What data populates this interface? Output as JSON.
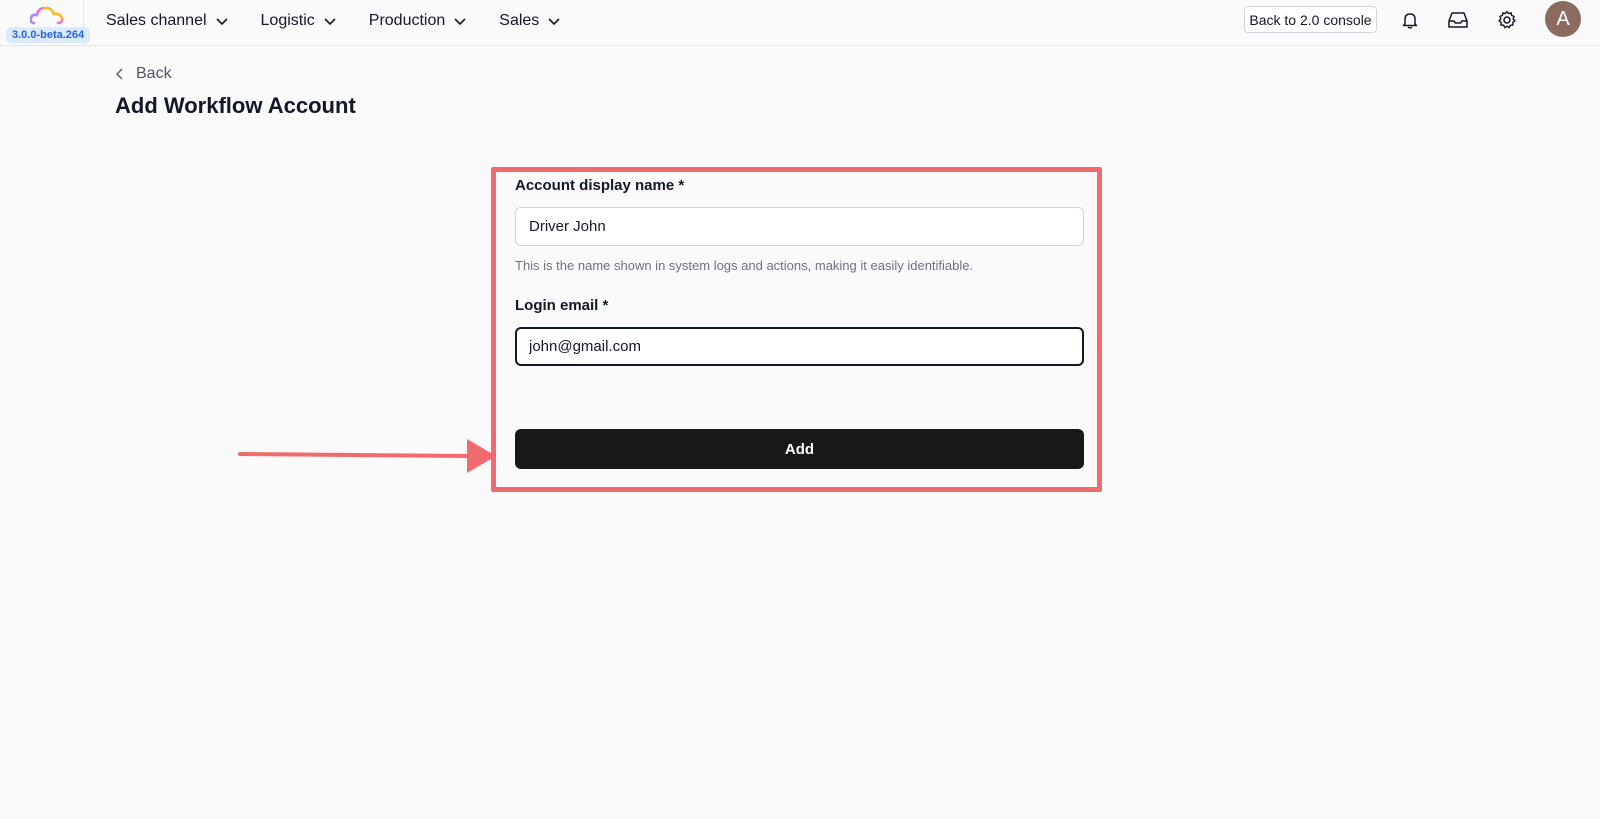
{
  "app": {
    "version": "3.0.0-beta.264",
    "logo_icon": "cloud-logo-icon"
  },
  "nav": {
    "items": [
      {
        "label": "Sales channel"
      },
      {
        "label": "Logistic"
      },
      {
        "label": "Production"
      },
      {
        "label": "Sales"
      }
    ]
  },
  "header_actions": {
    "console_label": "Back to 2.0 console",
    "avatar_initial": "A",
    "icons": [
      "bell-icon",
      "inbox-icon",
      "gear-icon"
    ]
  },
  "page": {
    "back_label": "Back",
    "title": "Add Workflow Account"
  },
  "form": {
    "display_name": {
      "label": "Account display name *",
      "value": "Driver John",
      "hint": "This is the name shown in system logs and actions, making it easily identifiable."
    },
    "login_email": {
      "label": "Login email *",
      "value": "john@gmail.com"
    },
    "submit_label": "Add"
  },
  "colors": {
    "highlight": "#f06a6e",
    "button": "#18181b",
    "version_badge_bg": "#dbeafe",
    "version_badge_text": "#2563eb"
  }
}
